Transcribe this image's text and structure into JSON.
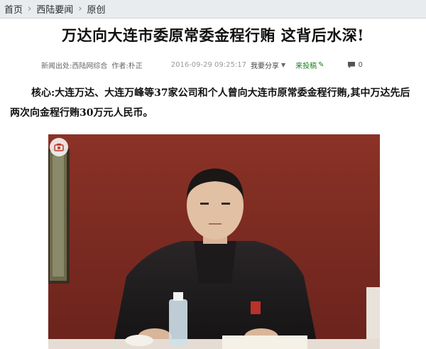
{
  "breadcrumb": {
    "items": [
      "首页",
      "西陆要闻",
      "原创"
    ]
  },
  "article": {
    "title": "万达向大连市委原常委金程行贿 这背后水深!",
    "meta": {
      "source": "新闻出处:西陆网综合",
      "author": "作者:朴正",
      "datetime": "2016-09-29 09:25:17",
      "share_label": "我要分享",
      "submit_label": "来投稿",
      "comment_count": "0"
    },
    "summary": "核心:大连万达、大连万峰等37家公司和个人曾向大连市原常委金程行贿,其中万达先后两次向金程行贿30万元人民币。"
  },
  "icons": {
    "camera": "camera-icon",
    "comment": "comment-icon",
    "chevron": "chevron-right-icon",
    "caret": "caret-down-icon",
    "pen": "pen-icon"
  },
  "colors": {
    "breadcrumb_bg": "#e9ecef",
    "submit_green": "#1f7a1f",
    "photo_backdrop": "#7a2a22"
  }
}
